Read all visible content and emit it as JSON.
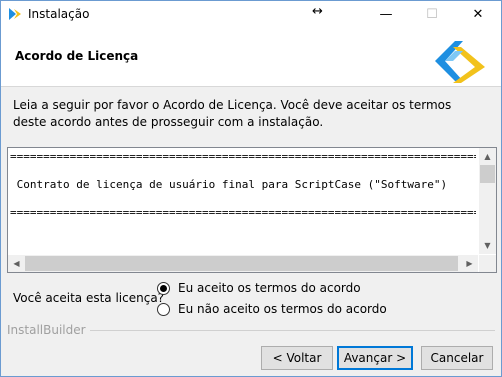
{
  "window": {
    "title": "Instalação",
    "controls": {
      "minimize": "—",
      "maximize": "☐",
      "close": "✕",
      "move": "↔"
    }
  },
  "header": {
    "title": "Acordo de Licença",
    "logo_icon": "installbuilder-logo"
  },
  "description": "Leia a seguir por favor o Acordo de Licença. Você deve aceitar os termos deste acordo antes de prosseguir com a instalação.",
  "license": {
    "separator": "===========================================================================",
    "line": " Contrato de licença de usuário final para ScriptCase (\"Software\")"
  },
  "question": {
    "label": "Você aceita esta licença?",
    "options": [
      {
        "label": "Eu aceito os termos do acordo",
        "selected": true
      },
      {
        "label": "Eu não aceito os termos do acordo",
        "selected": false
      }
    ]
  },
  "footer": {
    "brand": "InstallBuilder",
    "back_label": "< Voltar",
    "next_label": "Avançar >",
    "cancel_label": "Cancelar"
  },
  "colors": {
    "accent": "#0078d7",
    "logo_blue": "#1e8fe1",
    "logo_yellow": "#f2c21b"
  }
}
